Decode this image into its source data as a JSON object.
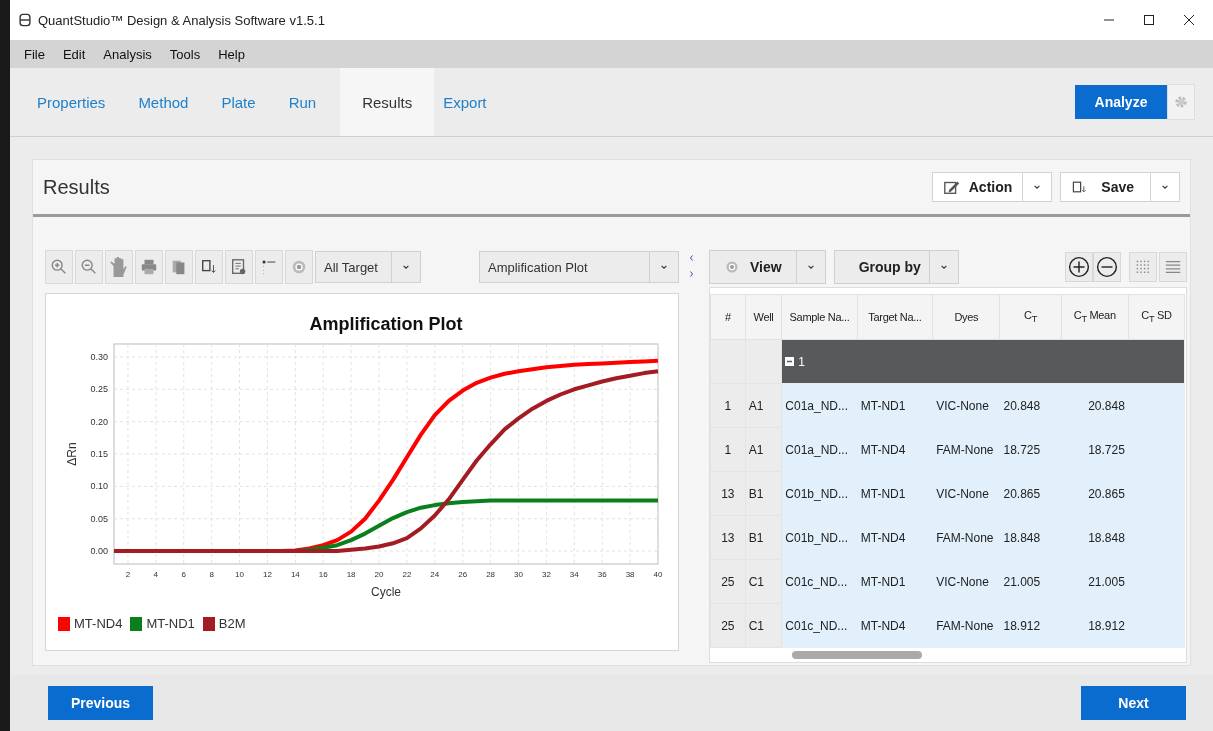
{
  "window": {
    "title": "QuantStudio™ Design & Analysis Software v1.5.1"
  },
  "menu": [
    "File",
    "Edit",
    "Analysis",
    "Tools",
    "Help"
  ],
  "workflow_tabs": [
    {
      "label": "Properties",
      "selected": false
    },
    {
      "label": "Method",
      "selected": false
    },
    {
      "label": "Plate",
      "selected": false
    },
    {
      "label": "Run",
      "selected": false
    },
    {
      "label": "Results",
      "selected": true
    },
    {
      "label": "Export",
      "selected": false
    }
  ],
  "analyze_button": "Analyze",
  "results_panel": {
    "title": "Results",
    "action_button": "Action",
    "save_button": "Save"
  },
  "plot_toolbar": {
    "target_filter": "All Target",
    "plot_type": "Amplification Plot"
  },
  "chart": {
    "chart_data": {
      "type": "line",
      "title": "Amplification Plot",
      "xlabel": "Cycle",
      "ylabel": "ΔRn",
      "x": [
        1,
        2,
        3,
        4,
        5,
        6,
        7,
        8,
        9,
        10,
        11,
        12,
        13,
        14,
        15,
        16,
        17,
        18,
        19,
        20,
        21,
        22,
        23,
        24,
        25,
        26,
        27,
        28,
        29,
        30,
        31,
        32,
        33,
        34,
        35,
        36,
        37,
        38,
        39,
        40
      ],
      "series": [
        {
          "name": "MT-ND4",
          "color": "#ff0000",
          "values": [
            null,
            null,
            null,
            null,
            null,
            null,
            null,
            null,
            null,
            null,
            null,
            null,
            0,
            0.001,
            0.004,
            0.009,
            0.017,
            0.03,
            0.05,
            0.078,
            0.11,
            0.145,
            0.18,
            0.21,
            0.232,
            0.248,
            0.26,
            0.268,
            0.274,
            0.278,
            0.281,
            0.284,
            0.286,
            0.288,
            0.289,
            0.29,
            0.291,
            0.292,
            0.293,
            0.294
          ]
        },
        {
          "name": "MT-ND1",
          "color": "#0a7f1e",
          "values": [
            null,
            null,
            null,
            null,
            null,
            null,
            null,
            null,
            null,
            null,
            null,
            null,
            0,
            0,
            0.002,
            0.005,
            0.009,
            0.017,
            0.027,
            0.039,
            0.051,
            0.06,
            0.067,
            0.071,
            0.074,
            0.076,
            0.077,
            0.078,
            0.078,
            0.078,
            0.078,
            0.078,
            0.078,
            0.078,
            0.078,
            0.078,
            0.078,
            0.078,
            0.078,
            0.078
          ]
        },
        {
          "name": "B2M",
          "color": "#a31c24",
          "values": [
            0,
            0,
            0,
            0,
            0,
            0,
            0,
            0,
            0,
            0,
            0,
            0,
            0,
            0,
            0,
            0,
            0,
            0.002,
            0.004,
            0.007,
            0.012,
            0.02,
            0.035,
            0.055,
            0.08,
            0.11,
            0.14,
            0.165,
            0.188,
            0.205,
            0.22,
            0.232,
            0.242,
            0.25,
            0.256,
            0.262,
            0.267,
            0.271,
            0.275,
            0.278
          ]
        }
      ],
      "grid": true,
      "legend": true,
      "xlim": [
        1,
        40
      ],
      "ylim": [
        -0.02,
        0.32
      ],
      "xticks": [
        2,
        4,
        6,
        8,
        10,
        12,
        14,
        16,
        18,
        20,
        22,
        24,
        26,
        28,
        30,
        32,
        34,
        36,
        38,
        40
      ],
      "yticks": [
        {
          "value": 0,
          "label": "0.00"
        },
        {
          "value": 0.05,
          "label": "0.05"
        },
        {
          "value": 0.1,
          "label": "0.10"
        },
        {
          "value": 0.15,
          "label": "0.15"
        },
        {
          "value": 0.2,
          "label": "0.20"
        },
        {
          "value": 0.25,
          "label": "0.25"
        },
        {
          "value": 0.3,
          "label": "0.30"
        }
      ]
    }
  },
  "table_toolbar": {
    "view_button": "View",
    "group_by_button": "Group by"
  },
  "table": {
    "columns": [
      "#",
      "Well",
      "Sample Na...",
      "Target Na...",
      "Dyes",
      "C$_{T}$",
      "C$_{T}$ Mean",
      "C$_{T}$ SD"
    ],
    "group": {
      "label": "1",
      "expanded": true
    },
    "rows": [
      {
        "number": "1",
        "well": "A1",
        "sample_name": "C01a_ND...",
        "target_name": "MT-ND1",
        "dyes": "VIC-None",
        "ct": "20.848",
        "ct_mean": "20.848"
      },
      {
        "number": "1",
        "well": "A1",
        "sample_name": "C01a_ND...",
        "target_name": "MT-ND4",
        "dyes": "FAM-None",
        "ct": "18.725",
        "ct_mean": "18.725"
      },
      {
        "number": "13",
        "well": "B1",
        "sample_name": "C01b_ND...",
        "target_name": "MT-ND1",
        "dyes": "VIC-None",
        "ct": "20.865",
        "ct_mean": "20.865"
      },
      {
        "number": "13",
        "well": "B1",
        "sample_name": "C01b_ND...",
        "target_name": "MT-ND4",
        "dyes": "FAM-None",
        "ct": "18.848",
        "ct_mean": "18.848"
      },
      {
        "number": "25",
        "well": "C1",
        "sample_name": "C01c_ND...",
        "target_name": "MT-ND1",
        "dyes": "VIC-None",
        "ct": "21.005",
        "ct_mean": "21.005"
      },
      {
        "number": "25",
        "well": "C1",
        "sample_name": "C01c_ND...",
        "target_name": "MT-ND4",
        "dyes": "FAM-None",
        "ct": "18.912",
        "ct_mean": "18.912"
      }
    ]
  },
  "footer": {
    "previous_button": "Previous",
    "next_button": "Next"
  }
}
